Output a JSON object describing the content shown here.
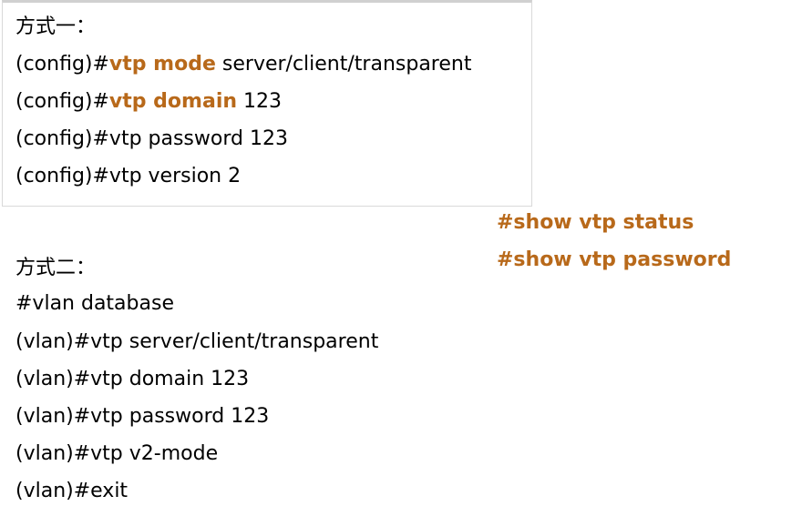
{
  "accent_color": "#b8691a",
  "method1": {
    "heading": "方式一：",
    "lines": [
      {
        "prefix": "(config)#",
        "highlight": "vtp mode",
        "rest": " server/client/transparent"
      },
      {
        "prefix": "(config)#",
        "highlight": "vtp domain",
        "rest": " 123"
      },
      {
        "prefix": "(config)#",
        "highlight": "",
        "rest": "vtp password 123"
      },
      {
        "prefix": "(config)#",
        "highlight": "",
        "rest": "vtp version 2"
      }
    ]
  },
  "show_commands": [
    "#show vtp status",
    "#show vtp password"
  ],
  "method2": {
    "heading": "方式二：",
    "lines": [
      "#vlan database",
      "(vlan)#vtp server/client/transparent",
      "(vlan)#vtp domain 123",
      "(vlan)#vtp password 123",
      "(vlan)#vtp v2-mode",
      "(vlan)#exit"
    ]
  }
}
